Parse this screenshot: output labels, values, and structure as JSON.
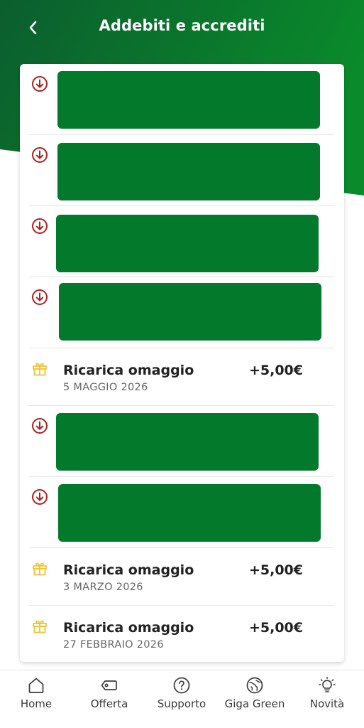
{
  "header": {
    "title": "Addebiti e accrediti"
  },
  "colors": {
    "header_gradient_start": "#0b5e2e",
    "header_gradient_end": "#0a8a2b",
    "redaction_green": "#037a2b",
    "debit_icon_red": "#b01e1e",
    "gift_icon_yellow": "#f2c230"
  },
  "transactions": [
    {
      "type": "debit",
      "icon": "arrow-down-circle-icon",
      "redacted": true
    },
    {
      "type": "debit",
      "icon": "arrow-down-circle-icon",
      "redacted": true
    },
    {
      "type": "debit",
      "icon": "arrow-down-circle-icon",
      "redacted": true
    },
    {
      "type": "debit",
      "icon": "arrow-down-circle-icon",
      "redacted": true
    },
    {
      "type": "credit",
      "icon": "gift-icon",
      "title": "Ricarica omaggio",
      "date": "5 MAGGIO 2026",
      "amount": "+5,00€"
    },
    {
      "type": "debit",
      "icon": "arrow-down-circle-icon",
      "redacted": true
    },
    {
      "type": "debit",
      "icon": "arrow-down-circle-icon",
      "redacted": true
    },
    {
      "type": "credit",
      "icon": "gift-icon",
      "title": "Ricarica omaggio",
      "date": "3 MARZO 2026",
      "amount": "+5,00€"
    },
    {
      "type": "credit",
      "icon": "gift-icon",
      "title": "Ricarica omaggio",
      "date": "27 FEBBRAIO 2026",
      "amount": "+5,00€"
    }
  ],
  "bottom_nav": [
    {
      "label": "Home",
      "icon": "home-icon"
    },
    {
      "label": "Offerta",
      "icon": "tag-icon"
    },
    {
      "label": "Supporto",
      "icon": "help-circle-icon"
    },
    {
      "label": "Giga Green",
      "icon": "globe-leaf-icon"
    },
    {
      "label": "Novità",
      "icon": "lightbulb-icon"
    }
  ]
}
